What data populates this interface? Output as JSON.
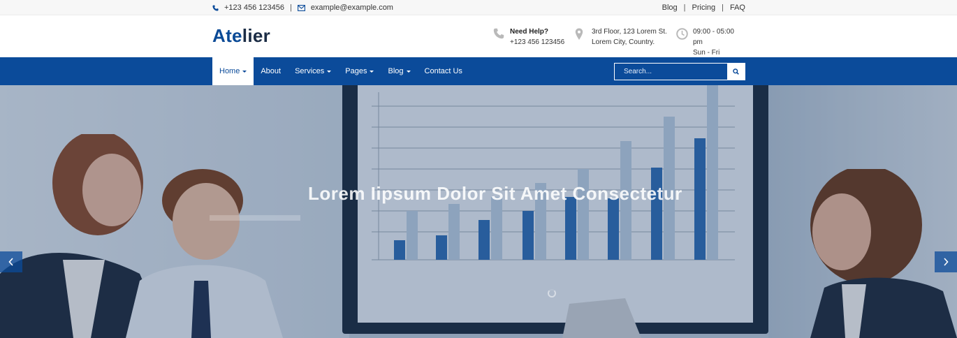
{
  "topbar": {
    "phone": "+123 456 123456",
    "email": "example@example.com",
    "links": [
      "Blog",
      "Pricing",
      "FAQ"
    ],
    "phone_icon": "phone-icon",
    "email_icon": "envelope-icon"
  },
  "header": {
    "logo_part1": "Ate",
    "logo_part2": "lier",
    "help_title": "Need Help?",
    "help_phone": "+123 456 123456",
    "address_line1": "3rd Floor, 123 Lorem St.",
    "address_line2": "Lorem City, Country.",
    "hours_line1": "09:00 - 05:00 pm",
    "hours_line2": "Sun - Fri",
    "icons": [
      "phone-icon",
      "map-marker-icon",
      "clock-icon"
    ]
  },
  "nav": {
    "items": [
      {
        "label": "Home",
        "dropdown": true,
        "active": true
      },
      {
        "label": "About",
        "dropdown": false,
        "active": false
      },
      {
        "label": "Services",
        "dropdown": true,
        "active": false
      },
      {
        "label": "Pages",
        "dropdown": true,
        "active": false
      },
      {
        "label": "Blog",
        "dropdown": true,
        "active": false
      },
      {
        "label": "Contact Us",
        "dropdown": false,
        "active": false
      }
    ],
    "search_placeholder": "Search..."
  },
  "hero": {
    "title": "Lorem Iipsum Dolor Sit Amet Consectetur",
    "prev_icon": "chevron-left-icon",
    "next_icon": "chevron-right-icon"
  },
  "colors": {
    "brand": "#0b4b9a",
    "logo_dark": "#1b2c45"
  }
}
